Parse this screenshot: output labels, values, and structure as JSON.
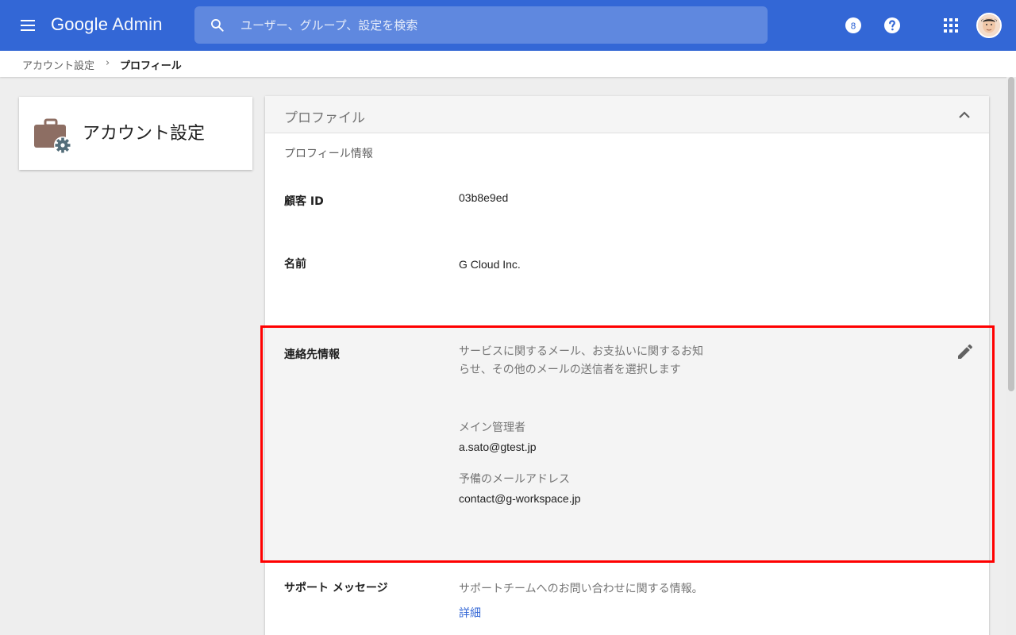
{
  "topbar": {
    "brand_google": "Google",
    "brand_admin": "Admin",
    "search_placeholder": "ユーザー、グループ、設定を検索",
    "timer_icon_text": "8"
  },
  "breadcrumb": {
    "parent": "アカウント設定",
    "separator": "›",
    "current": "プロフィール"
  },
  "left_card": {
    "title": "アカウント設定",
    "icon": "briefcase-gear-icon"
  },
  "profile": {
    "title": "プロファイル",
    "section_title": "プロフィール情報",
    "customer_id": {
      "label": "顧客 ID",
      "value": "03b8e9ed"
    },
    "name": {
      "label": "名前",
      "value": "G Cloud Inc."
    },
    "contact": {
      "label": "連絡先情報",
      "description": "サービスに関するメール、お支払いに関するお知らせ、その他のメールの送信者を選択します",
      "primary_admin_label": "メイン管理者",
      "primary_admin_value": "a.sato@gtest.jp",
      "secondary_email_label": "予備のメールアドレス",
      "secondary_email_value": "contact@g-workspace.jp"
    },
    "support": {
      "label": "サポート メッセージ",
      "description": "サポートチームへのお問い合わせに関する情報。",
      "link": "詳細"
    }
  },
  "colors": {
    "topbar": "#3367d6",
    "highlight_border": "#ff0000",
    "link": "#3367d6"
  }
}
